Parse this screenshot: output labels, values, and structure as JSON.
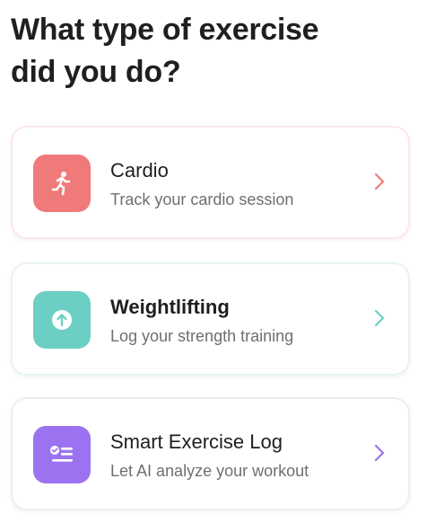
{
  "title_line1": "What type of exercise",
  "title_line2": "did you do?",
  "colors": {
    "cardio_tile": "#f07a7a",
    "cardio_chevron": "#f07a7a",
    "weight_tile": "#6ccfc4",
    "weight_chevron": "#6ccfc4",
    "smart_tile": "#9b73f0",
    "smart_chevron": "#9b73f0"
  },
  "options": [
    {
      "title": "Cardio",
      "subtitle": "Track your cardio session",
      "icon": "running-person-icon"
    },
    {
      "title": "Weightlifting",
      "subtitle": "Log your strength training",
      "icon": "arrow-up-circle-icon"
    },
    {
      "title": "Smart Exercise Log",
      "subtitle": "Let AI analyze your workout",
      "icon": "checklist-icon"
    }
  ]
}
